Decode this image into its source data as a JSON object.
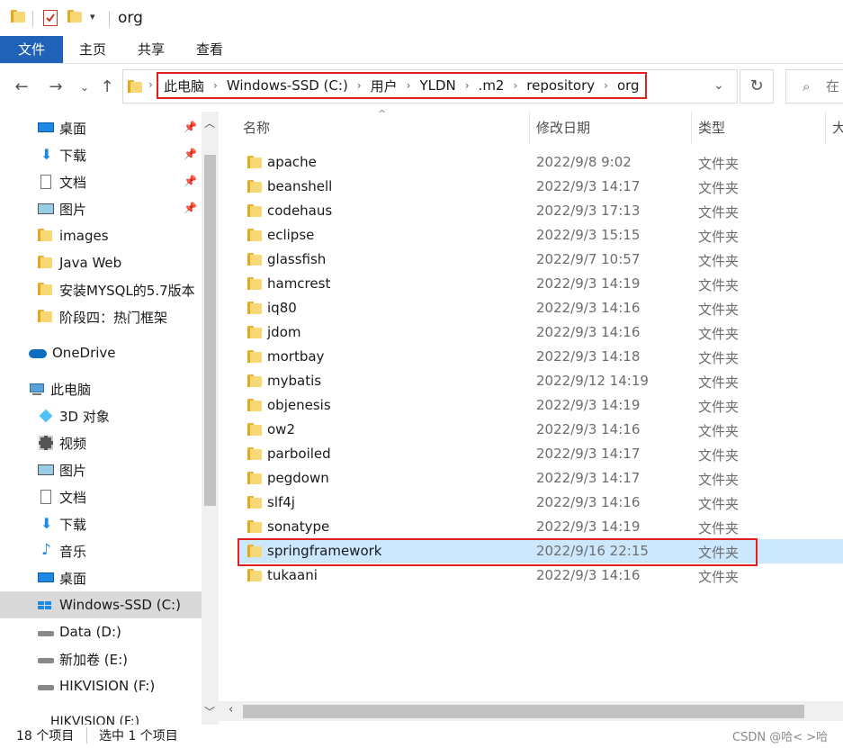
{
  "window": {
    "title": "org"
  },
  "ribbon": {
    "tabs": [
      "文件",
      "主页",
      "共享",
      "查看"
    ]
  },
  "address": {
    "crumbs": [
      "此电脑",
      "Windows-SSD (C:)",
      "用户",
      "YLDN",
      ".m2",
      "repository",
      "org"
    ],
    "search_placeholder": "在"
  },
  "nav": {
    "quick_access": [
      {
        "label": "桌面",
        "icon": "desktop-icon",
        "pinned": true
      },
      {
        "label": "下载",
        "icon": "download-icon",
        "pinned": true
      },
      {
        "label": "文档",
        "icon": "document-icon",
        "pinned": true
      },
      {
        "label": "图片",
        "icon": "picture-icon",
        "pinned": true
      },
      {
        "label": "images",
        "icon": "folder-icon",
        "pinned": false
      },
      {
        "label": "Java Web",
        "icon": "folder-icon",
        "pinned": false
      },
      {
        "label": "安装MYSQL的5.7版本",
        "icon": "folder-icon",
        "pinned": false
      },
      {
        "label": "阶段四：热门框架",
        "icon": "folder-icon",
        "pinned": false
      }
    ],
    "onedrive": "OneDrive",
    "this_pc": "此电脑",
    "pc_items": [
      {
        "label": "3D 对象",
        "icon": "3d-objects-icon"
      },
      {
        "label": "视频",
        "icon": "video-icon"
      },
      {
        "label": "图片",
        "icon": "picture-icon"
      },
      {
        "label": "文档",
        "icon": "document-icon"
      },
      {
        "label": "下载",
        "icon": "download-icon"
      },
      {
        "label": "音乐",
        "icon": "music-icon"
      },
      {
        "label": "桌面",
        "icon": "desktop-icon"
      },
      {
        "label": "Windows-SSD (C:)",
        "icon": "windows-drive-icon",
        "selected": true
      },
      {
        "label": "Data (D:)",
        "icon": "drive-icon"
      },
      {
        "label": "新加卷 (E:)",
        "icon": "drive-icon"
      },
      {
        "label": "HIKVISION (F:)",
        "icon": "drive-icon"
      },
      {
        "label": "HIKVISION (F:)",
        "icon": "drive-icon"
      }
    ]
  },
  "columns": {
    "name": "名称",
    "date": "修改日期",
    "type": "类型",
    "size": "大"
  },
  "files": [
    {
      "name": "apache",
      "date": "2022/9/8 9:02",
      "type": "文件夹"
    },
    {
      "name": "beanshell",
      "date": "2022/9/3 14:17",
      "type": "文件夹"
    },
    {
      "name": "codehaus",
      "date": "2022/9/3 17:13",
      "type": "文件夹"
    },
    {
      "name": "eclipse",
      "date": "2022/9/3 15:15",
      "type": "文件夹"
    },
    {
      "name": "glassfish",
      "date": "2022/9/7 10:57",
      "type": "文件夹"
    },
    {
      "name": "hamcrest",
      "date": "2022/9/3 14:19",
      "type": "文件夹"
    },
    {
      "name": "iq80",
      "date": "2022/9/3 14:16",
      "type": "文件夹"
    },
    {
      "name": "jdom",
      "date": "2022/9/3 14:16",
      "type": "文件夹"
    },
    {
      "name": "mortbay",
      "date": "2022/9/3 14:18",
      "type": "文件夹"
    },
    {
      "name": "mybatis",
      "date": "2022/9/12 14:19",
      "type": "文件夹"
    },
    {
      "name": "objenesis",
      "date": "2022/9/3 14:19",
      "type": "文件夹"
    },
    {
      "name": "ow2",
      "date": "2022/9/3 14:16",
      "type": "文件夹"
    },
    {
      "name": "parboiled",
      "date": "2022/9/3 14:17",
      "type": "文件夹"
    },
    {
      "name": "pegdown",
      "date": "2022/9/3 14:17",
      "type": "文件夹"
    },
    {
      "name": "slf4j",
      "date": "2022/9/3 14:16",
      "type": "文件夹"
    },
    {
      "name": "sonatype",
      "date": "2022/9/3 14:19",
      "type": "文件夹"
    },
    {
      "name": "springframework",
      "date": "2022/9/16 22:15",
      "type": "文件夹",
      "selected": true
    },
    {
      "name": "tukaani",
      "date": "2022/9/3 14:16",
      "type": "文件夹"
    }
  ],
  "status": {
    "count": "18 个项目",
    "selected": "选中 1 个项目"
  },
  "watermark": "CSDN @哈< >哈",
  "colors": {
    "accent": "#1f62b7",
    "selection": "#cce8ff",
    "highlight": "#e02020"
  }
}
